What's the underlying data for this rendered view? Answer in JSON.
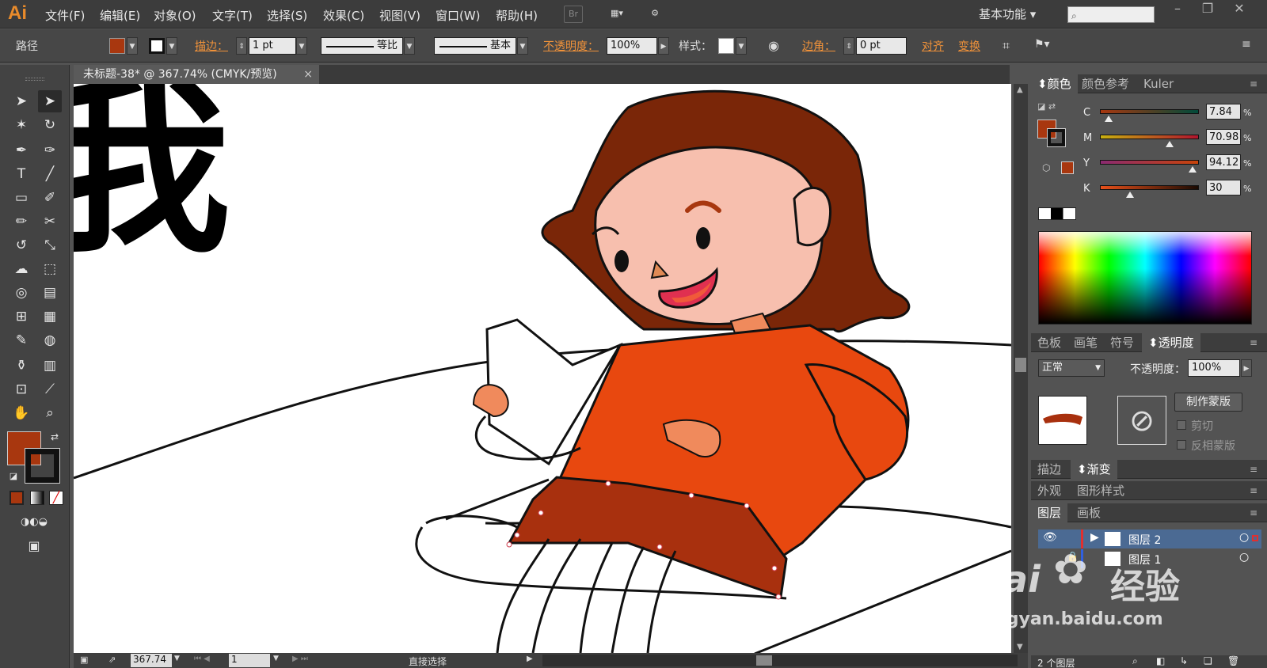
{
  "app": {
    "logo": "Ai"
  },
  "menu": [
    "文件(F)",
    "编辑(E)",
    "对象(O)",
    "文字(T)",
    "选择(S)",
    "效果(C)",
    "视图(V)",
    "窗口(W)",
    "帮助(H)"
  ],
  "menubar": {
    "br_label": "Br",
    "workspace": "基本功能"
  },
  "control": {
    "object_type": "路径",
    "stroke_label": "描边：",
    "stroke_weight": "1 pt",
    "profile_label": "等比",
    "brush_label": "基本",
    "opacity_label": "不透明度：",
    "opacity_value": "100%",
    "style_label": "样式：",
    "corner_label": "边角：",
    "corner_value": "0 pt",
    "align_label": "对齐",
    "transform_label": "变换",
    "fill_color": "#a8370f"
  },
  "document": {
    "tab_title": "未标题-38* @ 367.74% (CMYK/预览)",
    "close": "×"
  },
  "canvas": {
    "heading_char": "我"
  },
  "status": {
    "zoom": "367.74",
    "page": "1",
    "tool_name": "直接选择"
  },
  "color_panel": {
    "tabs": [
      "颜色",
      "颜色参考",
      "Kuler"
    ],
    "fill_color": "#a8370f",
    "cmyk": [
      {
        "label": "C",
        "value": "7.84",
        "level": 0.08
      },
      {
        "label": "M",
        "value": "70.98",
        "level": 0.71
      },
      {
        "label": "Y",
        "value": "94.12",
        "level": 0.94
      },
      {
        "label": "K",
        "value": "30",
        "level": 0.3
      }
    ],
    "pct": "%"
  },
  "transparency_panel": {
    "tabs": [
      "色板",
      "画笔",
      "符号",
      "透明度"
    ],
    "blend_mode": "正常",
    "opacity_label": "不透明度：",
    "opacity_value": "100%",
    "make_mask": "制作蒙版",
    "clip": "剪切",
    "invert_mask": "反相蒙版"
  },
  "stroke_panel": {
    "tabs": [
      "描边",
      "渐变"
    ]
  },
  "appearance_panel": {
    "tabs": [
      "外观",
      "图形样式"
    ]
  },
  "layers_panel": {
    "tabs": [
      "图层",
      "画板"
    ],
    "layers": [
      {
        "name": "图层 2",
        "color": "#e03030"
      },
      {
        "name": "图层 1",
        "color": "#3060e0"
      }
    ],
    "count": "2 个图层"
  },
  "watermark": {
    "brand": "Bai",
    "brand2": "经验",
    "url": "jingyan.baidu.com"
  }
}
